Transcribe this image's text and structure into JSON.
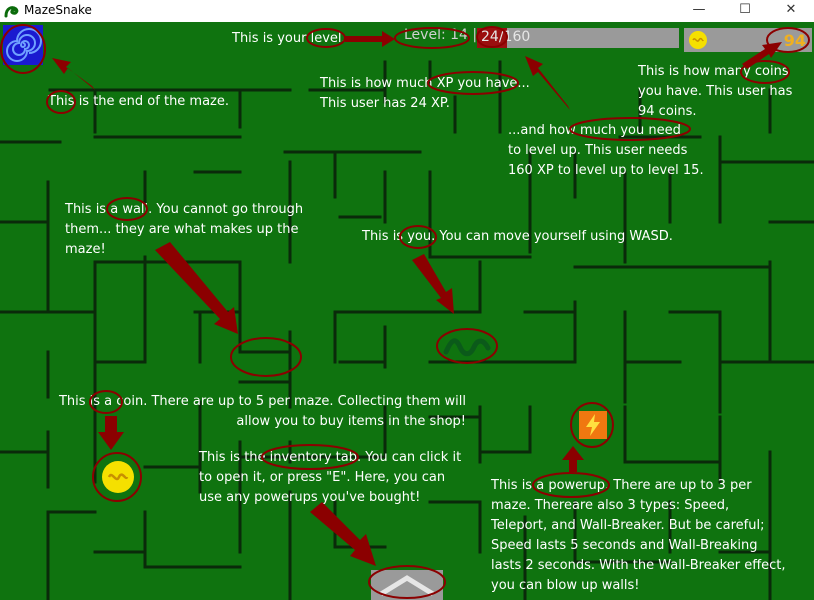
{
  "window": {
    "title": "MazeSnake",
    "minimize_glyph": "—",
    "maximize_glyph": "☐",
    "close_glyph": "✕"
  },
  "hud": {
    "level_text": "Level: 14 |",
    "xp_text": "24/160",
    "xp_current": 24,
    "xp_needed": 160,
    "coins": "94"
  },
  "annotations": {
    "level": "This is your level.",
    "xp_have": "This is how much XP you have...\nThis user has 24 XP.",
    "xp_need": "...and how much you need\nto level up. This user needs\n160 XP to level up to level 15.",
    "coins": "This is how many coins\nyou have. This user has\n94 coins.",
    "end": "This is the end of the maze.",
    "wall": "This is a wall. You cannot go through\nthem... they are what makes up the\nmaze!",
    "you": "This is you. You can move yourself using WASD.",
    "coin": "This is a coin. There are up to 5 per maze. Collecting them will\nallow you to buy items in the shop!",
    "inventory": "This is the inventory tab. You can click it\nto open it, or press \"E\". Here, you can\nuse any powerups you've bought!",
    "powerup": "This is a powerup. There are up to 3 per\nmaze. Thereare also 3 types: Speed,\nTeleport, and Wall-Breaker. But be careful;\nSpeed lasts 5 seconds and Wall-Breaking\nlasts 2 seconds. With the Wall-Breaker effect,\nyou can blow up walls!"
  },
  "colors": {
    "background": "#0f730f",
    "wall": "#0a2a0a",
    "annotation": "#8b0000",
    "coin": "#f5e000",
    "xp_fill": "#9b0f0f",
    "powerup": "#f07810",
    "exit": "#1a1ad0"
  }
}
